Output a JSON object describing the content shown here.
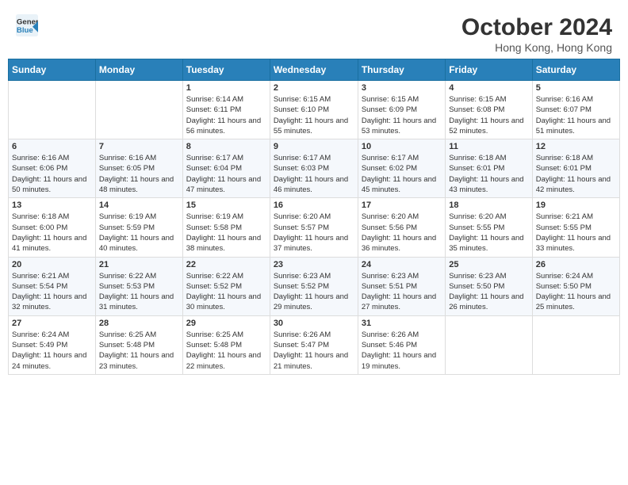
{
  "header": {
    "logo_line1": "General",
    "logo_line2": "Blue",
    "month": "October 2024",
    "location": "Hong Kong, Hong Kong"
  },
  "days_of_week": [
    "Sunday",
    "Monday",
    "Tuesday",
    "Wednesday",
    "Thursday",
    "Friday",
    "Saturday"
  ],
  "weeks": [
    [
      {
        "day": "",
        "sunrise": "",
        "sunset": "",
        "daylight": ""
      },
      {
        "day": "",
        "sunrise": "",
        "sunset": "",
        "daylight": ""
      },
      {
        "day": "1",
        "sunrise": "Sunrise: 6:14 AM",
        "sunset": "Sunset: 6:11 PM",
        "daylight": "Daylight: 11 hours and 56 minutes."
      },
      {
        "day": "2",
        "sunrise": "Sunrise: 6:15 AM",
        "sunset": "Sunset: 6:10 PM",
        "daylight": "Daylight: 11 hours and 55 minutes."
      },
      {
        "day": "3",
        "sunrise": "Sunrise: 6:15 AM",
        "sunset": "Sunset: 6:09 PM",
        "daylight": "Daylight: 11 hours and 53 minutes."
      },
      {
        "day": "4",
        "sunrise": "Sunrise: 6:15 AM",
        "sunset": "Sunset: 6:08 PM",
        "daylight": "Daylight: 11 hours and 52 minutes."
      },
      {
        "day": "5",
        "sunrise": "Sunrise: 6:16 AM",
        "sunset": "Sunset: 6:07 PM",
        "daylight": "Daylight: 11 hours and 51 minutes."
      }
    ],
    [
      {
        "day": "6",
        "sunrise": "Sunrise: 6:16 AM",
        "sunset": "Sunset: 6:06 PM",
        "daylight": "Daylight: 11 hours and 50 minutes."
      },
      {
        "day": "7",
        "sunrise": "Sunrise: 6:16 AM",
        "sunset": "Sunset: 6:05 PM",
        "daylight": "Daylight: 11 hours and 48 minutes."
      },
      {
        "day": "8",
        "sunrise": "Sunrise: 6:17 AM",
        "sunset": "Sunset: 6:04 PM",
        "daylight": "Daylight: 11 hours and 47 minutes."
      },
      {
        "day": "9",
        "sunrise": "Sunrise: 6:17 AM",
        "sunset": "Sunset: 6:03 PM",
        "daylight": "Daylight: 11 hours and 46 minutes."
      },
      {
        "day": "10",
        "sunrise": "Sunrise: 6:17 AM",
        "sunset": "Sunset: 6:02 PM",
        "daylight": "Daylight: 11 hours and 45 minutes."
      },
      {
        "day": "11",
        "sunrise": "Sunrise: 6:18 AM",
        "sunset": "Sunset: 6:01 PM",
        "daylight": "Daylight: 11 hours and 43 minutes."
      },
      {
        "day": "12",
        "sunrise": "Sunrise: 6:18 AM",
        "sunset": "Sunset: 6:01 PM",
        "daylight": "Daylight: 11 hours and 42 minutes."
      }
    ],
    [
      {
        "day": "13",
        "sunrise": "Sunrise: 6:18 AM",
        "sunset": "Sunset: 6:00 PM",
        "daylight": "Daylight: 11 hours and 41 minutes."
      },
      {
        "day": "14",
        "sunrise": "Sunrise: 6:19 AM",
        "sunset": "Sunset: 5:59 PM",
        "daylight": "Daylight: 11 hours and 40 minutes."
      },
      {
        "day": "15",
        "sunrise": "Sunrise: 6:19 AM",
        "sunset": "Sunset: 5:58 PM",
        "daylight": "Daylight: 11 hours and 38 minutes."
      },
      {
        "day": "16",
        "sunrise": "Sunrise: 6:20 AM",
        "sunset": "Sunset: 5:57 PM",
        "daylight": "Daylight: 11 hours and 37 minutes."
      },
      {
        "day": "17",
        "sunrise": "Sunrise: 6:20 AM",
        "sunset": "Sunset: 5:56 PM",
        "daylight": "Daylight: 11 hours and 36 minutes."
      },
      {
        "day": "18",
        "sunrise": "Sunrise: 6:20 AM",
        "sunset": "Sunset: 5:55 PM",
        "daylight": "Daylight: 11 hours and 35 minutes."
      },
      {
        "day": "19",
        "sunrise": "Sunrise: 6:21 AM",
        "sunset": "Sunset: 5:55 PM",
        "daylight": "Daylight: 11 hours and 33 minutes."
      }
    ],
    [
      {
        "day": "20",
        "sunrise": "Sunrise: 6:21 AM",
        "sunset": "Sunset: 5:54 PM",
        "daylight": "Daylight: 11 hours and 32 minutes."
      },
      {
        "day": "21",
        "sunrise": "Sunrise: 6:22 AM",
        "sunset": "Sunset: 5:53 PM",
        "daylight": "Daylight: 11 hours and 31 minutes."
      },
      {
        "day": "22",
        "sunrise": "Sunrise: 6:22 AM",
        "sunset": "Sunset: 5:52 PM",
        "daylight": "Daylight: 11 hours and 30 minutes."
      },
      {
        "day": "23",
        "sunrise": "Sunrise: 6:23 AM",
        "sunset": "Sunset: 5:52 PM",
        "daylight": "Daylight: 11 hours and 29 minutes."
      },
      {
        "day": "24",
        "sunrise": "Sunrise: 6:23 AM",
        "sunset": "Sunset: 5:51 PM",
        "daylight": "Daylight: 11 hours and 27 minutes."
      },
      {
        "day": "25",
        "sunrise": "Sunrise: 6:23 AM",
        "sunset": "Sunset: 5:50 PM",
        "daylight": "Daylight: 11 hours and 26 minutes."
      },
      {
        "day": "26",
        "sunrise": "Sunrise: 6:24 AM",
        "sunset": "Sunset: 5:50 PM",
        "daylight": "Daylight: 11 hours and 25 minutes."
      }
    ],
    [
      {
        "day": "27",
        "sunrise": "Sunrise: 6:24 AM",
        "sunset": "Sunset: 5:49 PM",
        "daylight": "Daylight: 11 hours and 24 minutes."
      },
      {
        "day": "28",
        "sunrise": "Sunrise: 6:25 AM",
        "sunset": "Sunset: 5:48 PM",
        "daylight": "Daylight: 11 hours and 23 minutes."
      },
      {
        "day": "29",
        "sunrise": "Sunrise: 6:25 AM",
        "sunset": "Sunset: 5:48 PM",
        "daylight": "Daylight: 11 hours and 22 minutes."
      },
      {
        "day": "30",
        "sunrise": "Sunrise: 6:26 AM",
        "sunset": "Sunset: 5:47 PM",
        "daylight": "Daylight: 11 hours and 21 minutes."
      },
      {
        "day": "31",
        "sunrise": "Sunrise: 6:26 AM",
        "sunset": "Sunset: 5:46 PM",
        "daylight": "Daylight: 11 hours and 19 minutes."
      },
      {
        "day": "",
        "sunrise": "",
        "sunset": "",
        "daylight": ""
      },
      {
        "day": "",
        "sunrise": "",
        "sunset": "",
        "daylight": ""
      }
    ]
  ]
}
